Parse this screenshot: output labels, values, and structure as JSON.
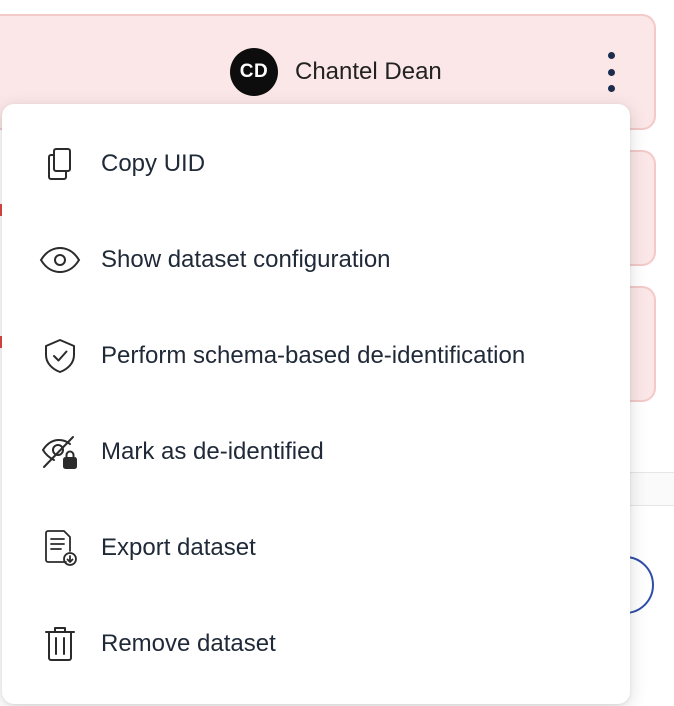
{
  "user": {
    "initials": "CD",
    "name": "Chantel Dean"
  },
  "menu": {
    "items": [
      {
        "label": "Copy UID",
        "icon": "copy-icon"
      },
      {
        "label": "Show dataset configuration",
        "icon": "eye-icon"
      },
      {
        "label": "Perform schema-based de-identification",
        "icon": "shield-check-icon"
      },
      {
        "label": "Mark as de-identified",
        "icon": "eye-off-lock-icon"
      },
      {
        "label": "Export dataset",
        "icon": "document-download-icon"
      },
      {
        "label": "Remove dataset",
        "icon": "trash-icon"
      }
    ]
  },
  "colors": {
    "card_background": "#fbe7e7",
    "card_border": "#f3c9c9",
    "avatar_background": "#0d0d0d",
    "accent_blue": "#2f4ea8"
  }
}
